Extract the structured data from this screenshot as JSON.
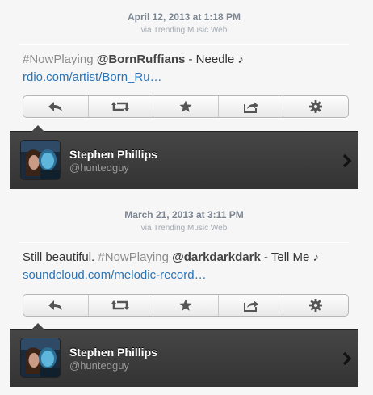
{
  "tweets": [
    {
      "date": "April 12, 2013 at 1:18 PM",
      "via": "via Trending Music Web",
      "hashtag": "#NowPlaying",
      "mention": "@BornRuffians",
      "text": " - Needle ♪ ",
      "link": "rdio.com/artist/Born_Ru…",
      "pre_text": ""
    },
    {
      "date": "March 21, 2013 at 3:11 PM",
      "via": "via Trending Music Web",
      "pre_text": "Still beautiful. ",
      "hashtag": "#NowPlaying",
      "mention": "@darkdarkdark",
      "text": " - Tell Me ♪",
      "link": "soundcloud.com/melodic-record…"
    }
  ],
  "actions": {
    "icons": [
      "reply-icon",
      "retweet-icon",
      "favorite-star-icon",
      "share-icon",
      "gear-icon"
    ]
  },
  "profile": {
    "name": "Stephen Phillips",
    "handle": "@huntedguy"
  },
  "colors": {
    "link": "#2b74b7",
    "profile_bar": "#3d3d3d"
  }
}
